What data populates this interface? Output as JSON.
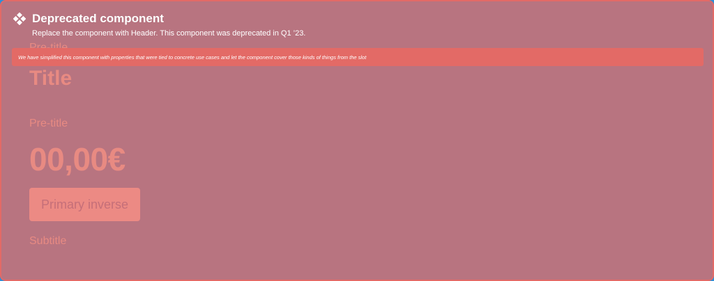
{
  "deprecation": {
    "icon": "component-diamond-icon",
    "title": "Deprecated component",
    "description": "Replace the component with Header. This component was deprecated in Q1 ’23.",
    "banner": "We have simplified this component with properties that were tied to concrete use cases and let the component cover those kinds of things from the slot"
  },
  "component": {
    "pretitle_top": "Pre-title",
    "title": "Title",
    "pretitle": "Pre-title",
    "amount": "00,00€",
    "button_label": "Primary inverse",
    "subtitle": "Subtitle"
  },
  "colors": {
    "overlay": "#b87480",
    "accent": "#e36a66",
    "ghost_text": "#e88a82",
    "outer_border": "#2b8fd8"
  }
}
